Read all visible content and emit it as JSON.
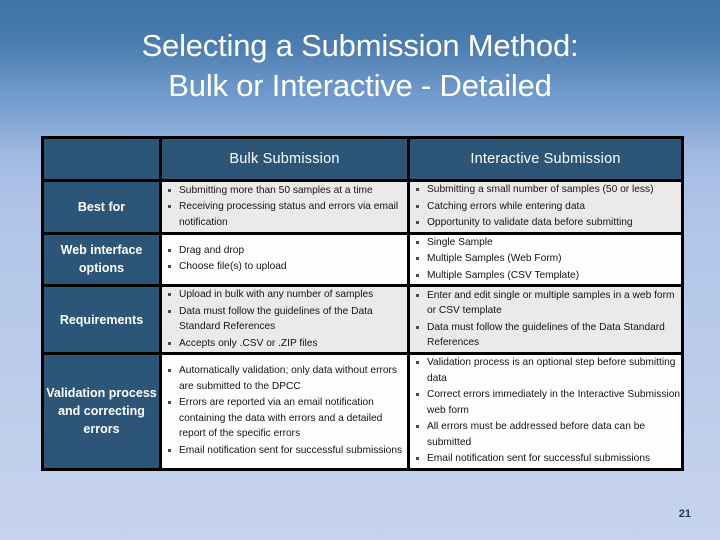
{
  "slide": {
    "title": "Selecting a Submission Method:\nBulk or Interactive - Detailed",
    "page_number": "21",
    "colors": {
      "header_blue": "#2c5578",
      "cell_gray": "#eaeaea",
      "title_text": "#ffffff",
      "page_number_text": "#1f3864",
      "background_top": "#3d74a8",
      "background_bottom": "#c6d3ed"
    }
  },
  "table": {
    "columns": [
      {
        "label": ""
      },
      {
        "label": "Bulk Submission"
      },
      {
        "label": "Interactive Submission"
      }
    ],
    "rows": [
      {
        "label": "Best for",
        "bulk": [
          "Submitting more than 50 samples at a time",
          "Receiving processing status and errors via email notification"
        ],
        "interactive": [
          "Submitting a small number of samples (50 or less)",
          "Catching errors while entering data",
          "Opportunity to validate data before submitting"
        ]
      },
      {
        "label": "Web interface options",
        "bulk": [
          "Drag and drop",
          "Choose file(s) to upload"
        ],
        "interactive": [
          "Single Sample",
          "Multiple Samples (Web Form)",
          "Multiple Samples (CSV Template)"
        ]
      },
      {
        "label": "Requirements",
        "bulk": [
          "Upload in bulk with any number of samples",
          "Data must follow the guidelines of the Data Standard References",
          "Accepts only .CSV or .ZIP files"
        ],
        "interactive": [
          "Enter and edit single or multiple samples in a web form or CSV template",
          "Data must follow the guidelines of the Data Standard References"
        ]
      },
      {
        "label": "Validation process and correcting errors",
        "bulk": [
          "Automatically validation; only data without errors are submitted to the DPCC",
          "Errors are reported via an email notification containing the data with errors and a detailed report of the specific errors",
          "Email notification sent for successful submissions"
        ],
        "interactive": [
          "Validation process is an optional step before submitting data",
          "Correct errors immediately in the Interactive Submission web form",
          "All errors must be addressed before data can be submitted",
          "Email notification sent for successful submissions"
        ]
      }
    ]
  }
}
